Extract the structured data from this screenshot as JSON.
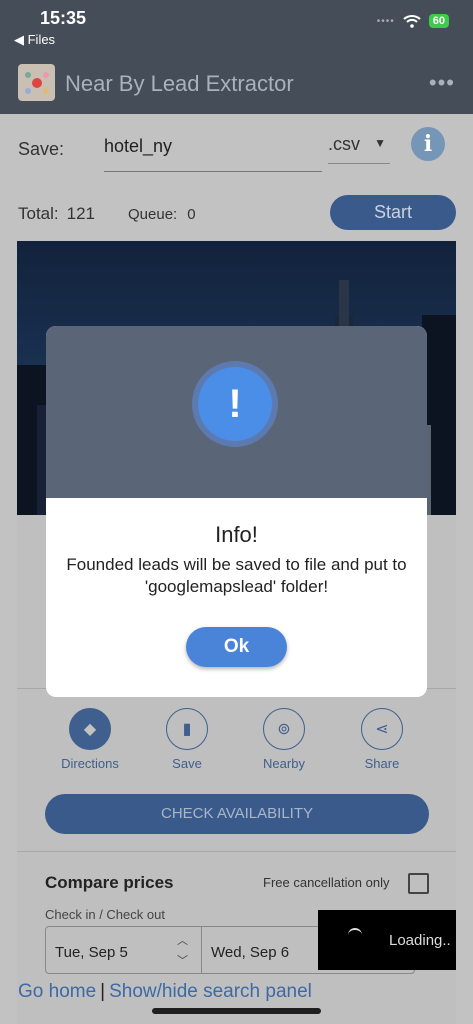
{
  "status_bar": {
    "time": "15:35",
    "back_label": "◀ Files",
    "battery": "60"
  },
  "app_bar": {
    "title": "Near By Lead Extractor",
    "more_icon": "more-horizontal-icon"
  },
  "save_row": {
    "label": "Save:",
    "filename": "hotel_ny",
    "extension": ".csv",
    "info_icon": "info-icon"
  },
  "stats": {
    "total_label": "Total:",
    "total_value": "121",
    "queue_label": "Queue:",
    "queue_value": "0",
    "start_label": "Start"
  },
  "place": {
    "actions": [
      {
        "label": "Directions",
        "icon": "directions-icon"
      },
      {
        "label": "Save",
        "icon": "bookmark-icon"
      },
      {
        "label": "Nearby",
        "icon": "nearby-icon"
      },
      {
        "label": "Share",
        "icon": "share-icon"
      }
    ],
    "check_availability": "CHECK AVAILABILITY",
    "compare_prices": "Compare prices",
    "free_cancellation": "Free cancellation only",
    "checkin_label": "Check in / Check out",
    "checkin_date": "Tue, Sep 5",
    "checkout_date": "Wed, Sep 6"
  },
  "loading": {
    "text": "Loading.."
  },
  "footer": {
    "go_home": "Go home",
    "toggle_search": "Show/hide search panel"
  },
  "dialog": {
    "icon": "!",
    "title": "Info!",
    "message": "Founded leads will be saved to file and put to 'googlemapslead' folder!",
    "ok_label": "Ok"
  },
  "colors": {
    "accent": "#4a84d8",
    "appbar": "#454e58",
    "dialog_header": "#5a6578"
  }
}
